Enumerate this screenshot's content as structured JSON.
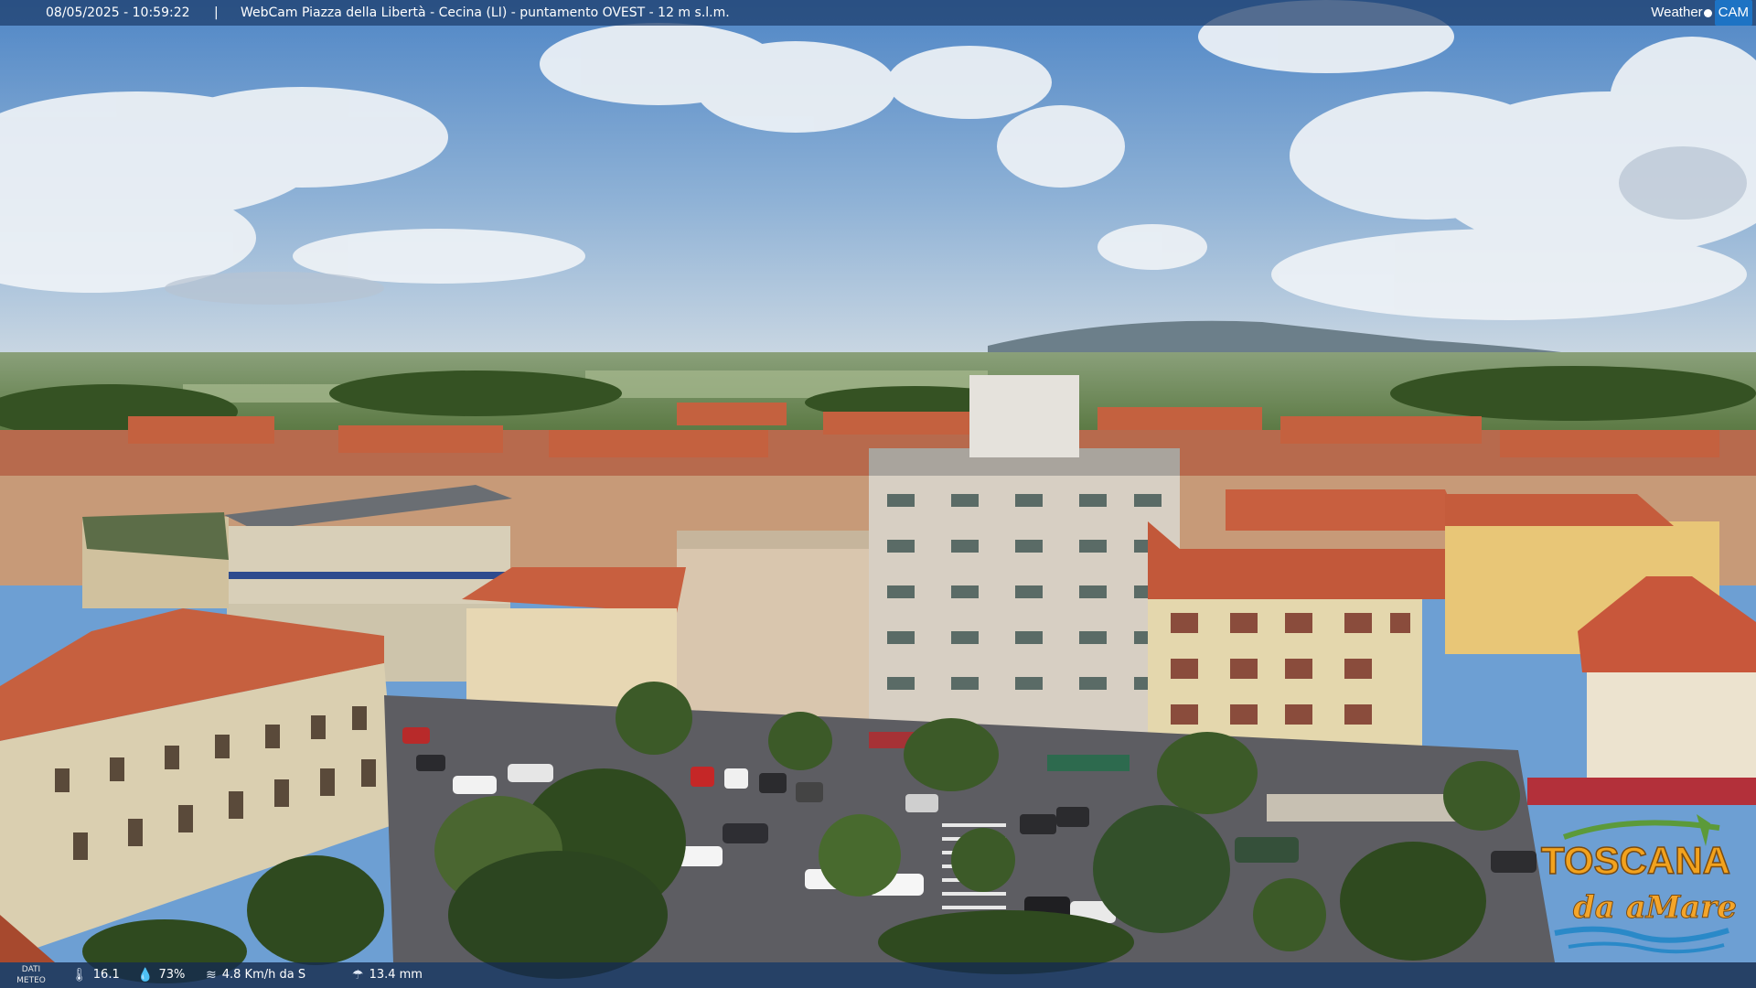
{
  "header": {
    "datetime": "08/05/2025 - 10:59:22",
    "separator": "|",
    "title": "WebCam Piazza della Libertà - Cecina (LI) - puntamento OVEST - 12 m s.l.m.",
    "brand_part1": "Weather",
    "brand_part2": "CAM"
  },
  "weather": {
    "label": "DATI METEO",
    "temperature": "16.1",
    "humidity": "73%",
    "wind": "4.8 Km/h da S",
    "rain": "13.4 mm",
    "icons": {
      "temperature": "thermometer-icon",
      "humidity": "drop-icon",
      "wind": "wind-icon",
      "rain": "rain-icon"
    }
  },
  "logo": {
    "line1": "TOSCANA",
    "line2": "da aMare"
  },
  "colors": {
    "sky_top": "#4f86c6",
    "sky_horizon": "#c8d7e6",
    "roof": "#c45a3c",
    "wall_cream": "#e8d7b0",
    "tree": "#3f5e2a",
    "road": "#5a5a5e",
    "bar": "#1c3c69",
    "logo_orange": "#f0a21c",
    "logo_blue": "#2a89c8"
  }
}
